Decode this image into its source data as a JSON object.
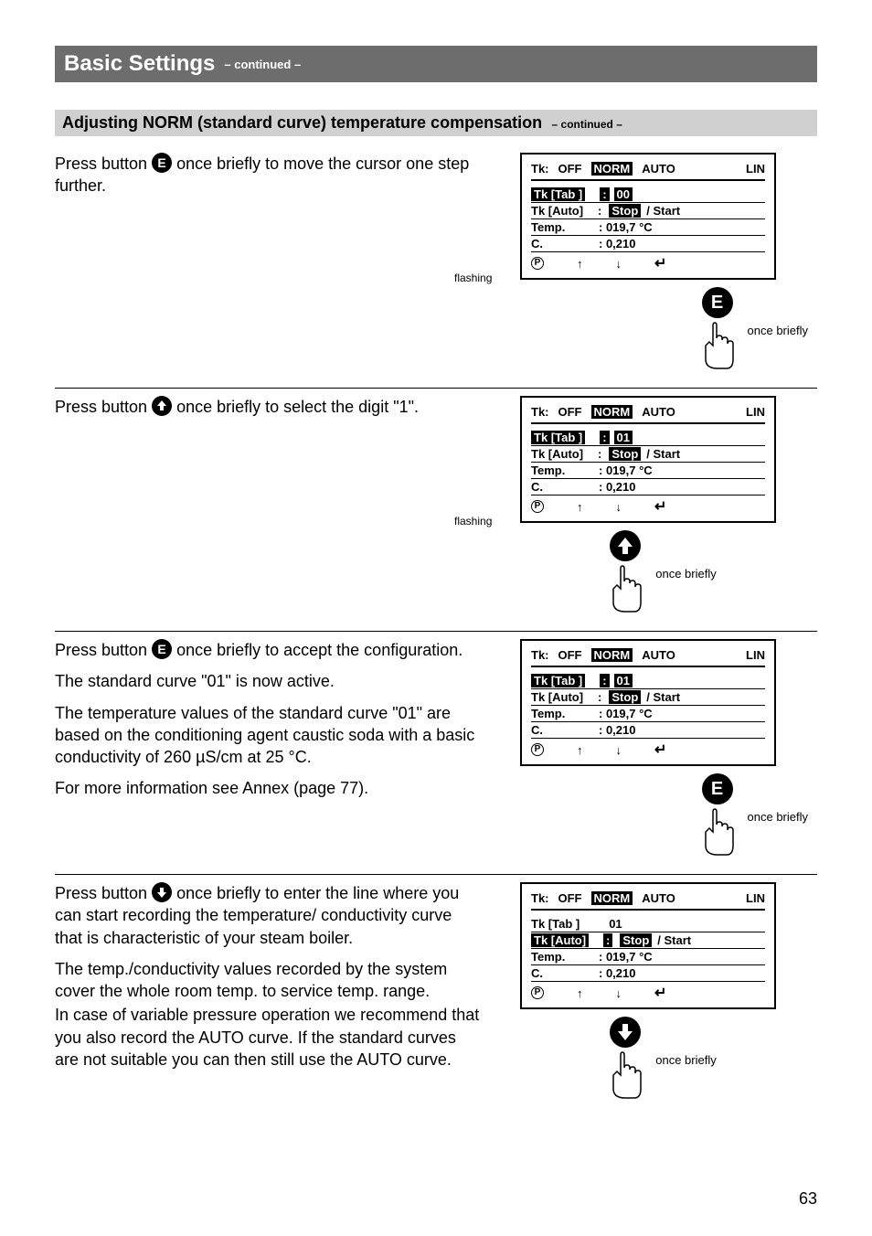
{
  "page": {
    "title": "Basic Settings",
    "title_sub": "– continued –",
    "subtitle": "Adjusting NORM (standard curve) temperature compensation",
    "subtitle_sub": "– continued –",
    "number": "63",
    "flashing": "flashing",
    "once_briefly": "once briefly"
  },
  "lcd_common": {
    "tk": "Tk:",
    "off": "OFF",
    "norm": "NORM",
    "auto": "AUTO",
    "lin": "LIN",
    "tk_tab": "Tk [Tab ]",
    "tk_auto": "Tk [Auto]",
    "temp": "Temp.",
    "c": "C.",
    "stop": "Stop",
    "start": "/ Start",
    "colon": ":",
    "temp_val": ": 019,7 °C",
    "c_val": ": 0,210"
  },
  "steps": [
    {
      "text_a": "Press button ",
      "text_b": " once briefly to move the cursor one step further.",
      "button_type": "E",
      "tab_val": "00",
      "tab_inv_label": true,
      "tab_inv_colon": true,
      "auto_inv_label": false,
      "hand_pos": "right",
      "has_flashing": true
    },
    {
      "text_a": "Press button ",
      "text_b": " once briefly to select the digit \"1\".",
      "button_type": "UP",
      "tab_val": "01",
      "tab_inv_label": true,
      "tab_inv_colon": true,
      "auto_inv_label": false,
      "hand_pos": "center",
      "has_flashing": true
    },
    {
      "text_a": "Press button ",
      "text_b": " once briefly to accept the configuration.",
      "extra": [
        "The standard curve \"01\" is now active.",
        "The temperature values of the standard curve \"01\" are based on the conditioning agent caustic soda with a basic conductivity of 260 µS/cm at 25 °C.",
        "For more information see Annex (page 77)."
      ],
      "button_type": "E",
      "tab_val": "01",
      "tab_inv_label": true,
      "tab_inv_colon": true,
      "auto_inv_label": false,
      "hand_pos": "right",
      "has_flashing": false
    },
    {
      "text_a": "Press button ",
      "text_b": " once briefly to enter the line where you can start recording the temperature/ conductivity curve that is characteristic of your steam boiler.",
      "extra_compact": [
        "The temp./conductivity values recorded by the system cover the whole room temp. to service temp. range.",
        "In case of variable pressure operation we recommend that you also record the AUTO curve. If the standard curves are not suitable you can then still use the AUTO curve."
      ],
      "button_type": "DOWN",
      "tab_val": "01",
      "tab_inv_label": false,
      "tab_inv_colon": false,
      "auto_inv_label": true,
      "hand_pos": "center",
      "has_flashing": false
    }
  ]
}
